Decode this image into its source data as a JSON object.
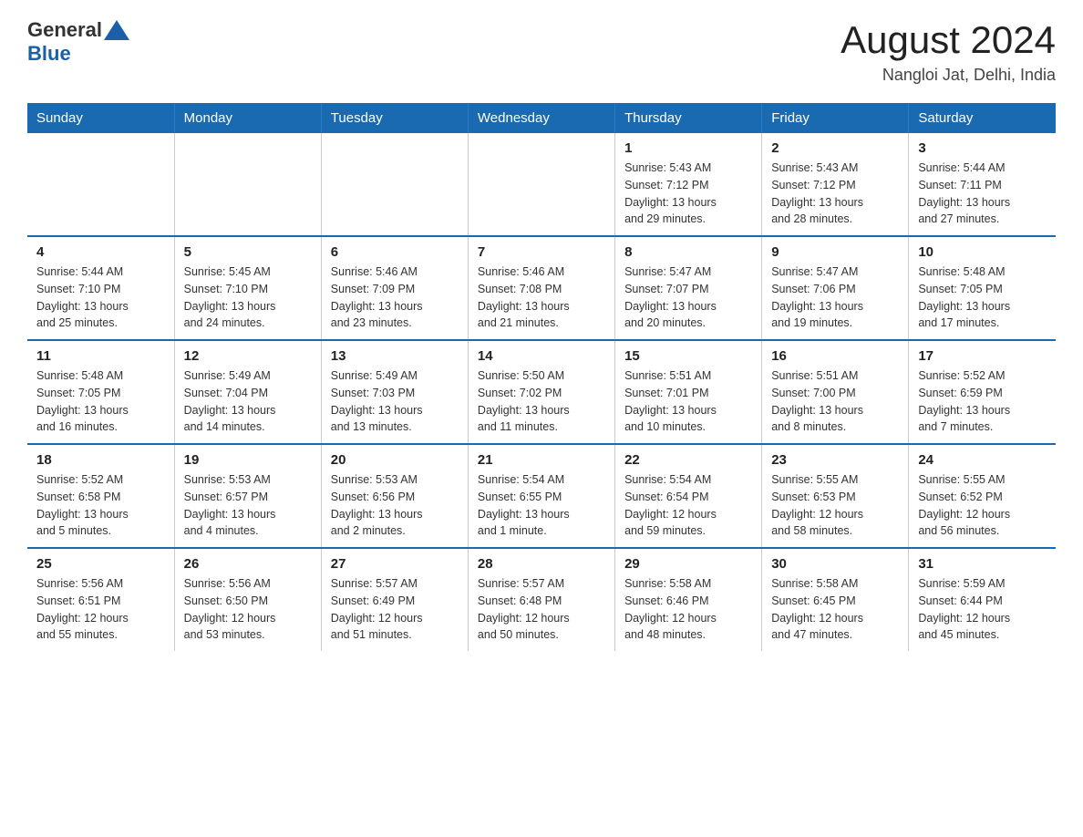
{
  "logo": {
    "text_general": "General",
    "text_blue": "Blue"
  },
  "title": "August 2024",
  "subtitle": "Nangloi Jat, Delhi, India",
  "days_of_week": [
    "Sunday",
    "Monday",
    "Tuesday",
    "Wednesday",
    "Thursday",
    "Friday",
    "Saturday"
  ],
  "weeks": [
    {
      "days": [
        {
          "number": "",
          "info": ""
        },
        {
          "number": "",
          "info": ""
        },
        {
          "number": "",
          "info": ""
        },
        {
          "number": "",
          "info": ""
        },
        {
          "number": "1",
          "info": "Sunrise: 5:43 AM\nSunset: 7:12 PM\nDaylight: 13 hours\nand 29 minutes."
        },
        {
          "number": "2",
          "info": "Sunrise: 5:43 AM\nSunset: 7:12 PM\nDaylight: 13 hours\nand 28 minutes."
        },
        {
          "number": "3",
          "info": "Sunrise: 5:44 AM\nSunset: 7:11 PM\nDaylight: 13 hours\nand 27 minutes."
        }
      ]
    },
    {
      "days": [
        {
          "number": "4",
          "info": "Sunrise: 5:44 AM\nSunset: 7:10 PM\nDaylight: 13 hours\nand 25 minutes."
        },
        {
          "number": "5",
          "info": "Sunrise: 5:45 AM\nSunset: 7:10 PM\nDaylight: 13 hours\nand 24 minutes."
        },
        {
          "number": "6",
          "info": "Sunrise: 5:46 AM\nSunset: 7:09 PM\nDaylight: 13 hours\nand 23 minutes."
        },
        {
          "number": "7",
          "info": "Sunrise: 5:46 AM\nSunset: 7:08 PM\nDaylight: 13 hours\nand 21 minutes."
        },
        {
          "number": "8",
          "info": "Sunrise: 5:47 AM\nSunset: 7:07 PM\nDaylight: 13 hours\nand 20 minutes."
        },
        {
          "number": "9",
          "info": "Sunrise: 5:47 AM\nSunset: 7:06 PM\nDaylight: 13 hours\nand 19 minutes."
        },
        {
          "number": "10",
          "info": "Sunrise: 5:48 AM\nSunset: 7:05 PM\nDaylight: 13 hours\nand 17 minutes."
        }
      ]
    },
    {
      "days": [
        {
          "number": "11",
          "info": "Sunrise: 5:48 AM\nSunset: 7:05 PM\nDaylight: 13 hours\nand 16 minutes."
        },
        {
          "number": "12",
          "info": "Sunrise: 5:49 AM\nSunset: 7:04 PM\nDaylight: 13 hours\nand 14 minutes."
        },
        {
          "number": "13",
          "info": "Sunrise: 5:49 AM\nSunset: 7:03 PM\nDaylight: 13 hours\nand 13 minutes."
        },
        {
          "number": "14",
          "info": "Sunrise: 5:50 AM\nSunset: 7:02 PM\nDaylight: 13 hours\nand 11 minutes."
        },
        {
          "number": "15",
          "info": "Sunrise: 5:51 AM\nSunset: 7:01 PM\nDaylight: 13 hours\nand 10 minutes."
        },
        {
          "number": "16",
          "info": "Sunrise: 5:51 AM\nSunset: 7:00 PM\nDaylight: 13 hours\nand 8 minutes."
        },
        {
          "number": "17",
          "info": "Sunrise: 5:52 AM\nSunset: 6:59 PM\nDaylight: 13 hours\nand 7 minutes."
        }
      ]
    },
    {
      "days": [
        {
          "number": "18",
          "info": "Sunrise: 5:52 AM\nSunset: 6:58 PM\nDaylight: 13 hours\nand 5 minutes."
        },
        {
          "number": "19",
          "info": "Sunrise: 5:53 AM\nSunset: 6:57 PM\nDaylight: 13 hours\nand 4 minutes."
        },
        {
          "number": "20",
          "info": "Sunrise: 5:53 AM\nSunset: 6:56 PM\nDaylight: 13 hours\nand 2 minutes."
        },
        {
          "number": "21",
          "info": "Sunrise: 5:54 AM\nSunset: 6:55 PM\nDaylight: 13 hours\nand 1 minute."
        },
        {
          "number": "22",
          "info": "Sunrise: 5:54 AM\nSunset: 6:54 PM\nDaylight: 12 hours\nand 59 minutes."
        },
        {
          "number": "23",
          "info": "Sunrise: 5:55 AM\nSunset: 6:53 PM\nDaylight: 12 hours\nand 58 minutes."
        },
        {
          "number": "24",
          "info": "Sunrise: 5:55 AM\nSunset: 6:52 PM\nDaylight: 12 hours\nand 56 minutes."
        }
      ]
    },
    {
      "days": [
        {
          "number": "25",
          "info": "Sunrise: 5:56 AM\nSunset: 6:51 PM\nDaylight: 12 hours\nand 55 minutes."
        },
        {
          "number": "26",
          "info": "Sunrise: 5:56 AM\nSunset: 6:50 PM\nDaylight: 12 hours\nand 53 minutes."
        },
        {
          "number": "27",
          "info": "Sunrise: 5:57 AM\nSunset: 6:49 PM\nDaylight: 12 hours\nand 51 minutes."
        },
        {
          "number": "28",
          "info": "Sunrise: 5:57 AM\nSunset: 6:48 PM\nDaylight: 12 hours\nand 50 minutes."
        },
        {
          "number": "29",
          "info": "Sunrise: 5:58 AM\nSunset: 6:46 PM\nDaylight: 12 hours\nand 48 minutes."
        },
        {
          "number": "30",
          "info": "Sunrise: 5:58 AM\nSunset: 6:45 PM\nDaylight: 12 hours\nand 47 minutes."
        },
        {
          "number": "31",
          "info": "Sunrise: 5:59 AM\nSunset: 6:44 PM\nDaylight: 12 hours\nand 45 minutes."
        }
      ]
    }
  ]
}
